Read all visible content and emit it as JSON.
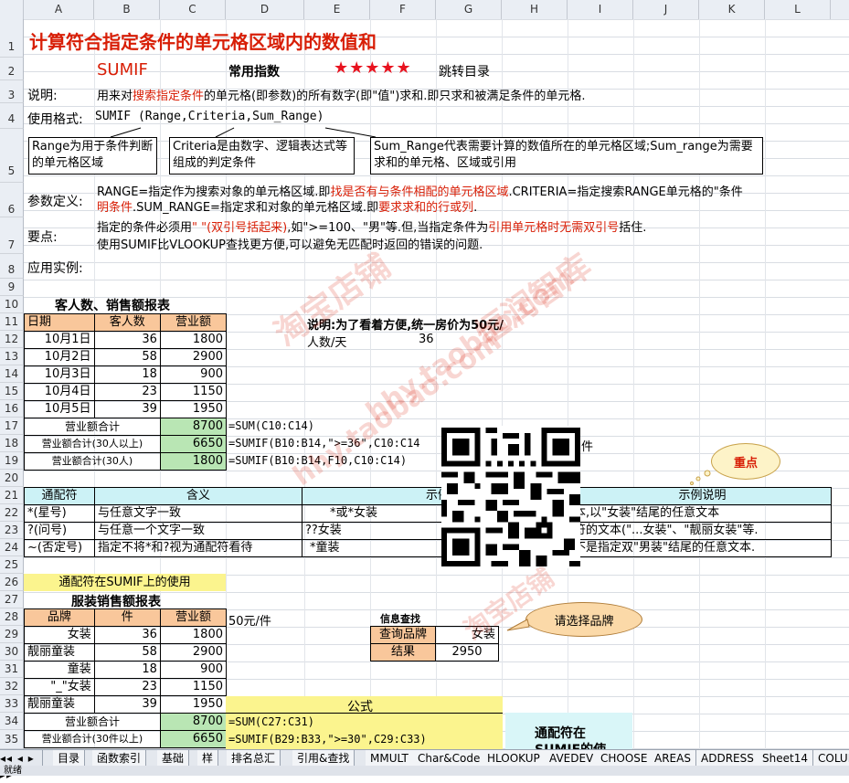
{
  "columns": [
    "A",
    "B",
    "C",
    "D",
    "E",
    "F",
    "G",
    "H",
    "I",
    "J",
    "K",
    "L"
  ],
  "rows": [
    "1",
    "2",
    "3",
    "4",
    "5",
    "6",
    "7",
    "8",
    "9",
    "10",
    "11",
    "12",
    "13",
    "14",
    "15",
    "16",
    "17",
    "18",
    "19",
    "20",
    "21",
    "22",
    "23",
    "24",
    "25",
    "26",
    "27",
    "28",
    "29",
    "30",
    "31",
    "32",
    "33",
    "34",
    "35"
  ],
  "title": "计算符合指定条件的单元格区域内的数值和",
  "func_name": "SUMIF",
  "common_label": "常用指数",
  "stars": "★★★★★",
  "jump_link": "跳转目录",
  "desc_label": "说明:",
  "desc_a": "用来对",
  "desc_b": "搜索指定条件",
  "desc_c": "的单元格(即参数)的所有数字(即\"值\")求和.即只求和被满足条件的单元格.",
  "format_label": "使用格式:",
  "format_text": "SUMIF (Range,Criteria,Sum_Range)",
  "box_range": "Range为用于条件判断的单元格区域",
  "box_criteria": "Criteria是由数字、逻辑表达式等组成的判定条件",
  "box_sumrange": "Sum_Range代表需要计算的数值所在的单元格区域;Sum_range为需要求和的单元格、区域或引用",
  "param_label": "参数定义:",
  "param_a": "RANGE=指定作为搜索对象的单元格区域.即",
  "param_b": "找是否有与条件相配的单元格区域",
  "param_c": ".CRITERIA=指定搜索RANGE单元格的\"条件",
  "param_d": "明条件",
  "param_e": ".SUM_RANGE=指定求和对象的单元格区域.即",
  "param_f": "要求求和的行或列",
  "param_g": ".",
  "key_label": "要点:",
  "key_a": "指定的条件必须用",
  "key_b": "\" \"(双引号括起来)",
  "key_c": ",如\">=100、\"男\"等.但,当指定条件为",
  "key_d": "引用单元格时无需双引号",
  "key_e": "括住.",
  "key_line2": "使用SUMIF比VLOOKUP查找更方便,可以避免无匹配时返回的错误的问题.",
  "example_label": "应用实例:",
  "table1": {
    "title": "客人数、销售额报表",
    "headers": [
      "日期",
      "客人数",
      "营业额"
    ],
    "rows": [
      [
        "10月1日",
        "36",
        "1800"
      ],
      [
        "10月2日",
        "58",
        "2900"
      ],
      [
        "10月3日",
        "18",
        "900"
      ],
      [
        "10月4日",
        "23",
        "1150"
      ],
      [
        "10月5日",
        "39",
        "1950"
      ]
    ],
    "sum_rows": [
      {
        "label": "营业额合计",
        "value": "8700",
        "formula": "=SUM(C10:C14)"
      },
      {
        "label": "营业额合计(30人以上)",
        "value": "6650",
        "formula": "=SUMIF(B10:B14,\">=36\",C10:C14"
      },
      {
        "label": "营业额合计(30人)",
        "value": "1800",
        "formula": "=SUMIF(B10:B14,F10,C10:C14)"
      }
    ]
  },
  "note_bold": "说明:为了看着方便,统一房价为50元/",
  "note_people_label": "人数/天",
  "note_people_value": "36",
  "g18_tail": "件",
  "highlight_bubble": "重点",
  "wildcard": {
    "headers": [
      "通配符",
      "含义",
      "示例",
      "示例说明"
    ],
    "rows": [
      [
        "*(星号)",
        "与任意文字一致",
        "*或*女装",
        "本,以\"女装\"结尾的任意文本"
      ],
      [
        "?(问号)",
        "与任意一个文字一致",
        "??女装",
        "符的文本(\"...女装\"、\"靓丽女装\"等."
      ],
      [
        "~(否定号)",
        "指定不将*和?视为通配符看待",
        "*童装",
        "不是指定双\"男装\"结尾的任意文本."
      ]
    ]
  },
  "wildcard_use": "通配符在SUMIF上的使用",
  "table2": {
    "title": "服装销售额报表",
    "headers": [
      "品牌",
      "件",
      "营业额"
    ],
    "rows": [
      [
        "女装",
        "36",
        "1800"
      ],
      [
        "靓丽童装",
        "58",
        "2900"
      ],
      [
        "童装",
        "18",
        "900"
      ],
      [
        "\"_\"女装",
        "23",
        "1150"
      ],
      [
        "靓丽童装",
        "39",
        "1950"
      ]
    ],
    "sum_rows": [
      {
        "label": "营业额合计",
        "value": "8700",
        "formula": "=SUM(C27:C31)"
      },
      {
        "label": "营业额合计(30件以上)",
        "value": "6650",
        "formula": "=SUMIF(B29:B33,\">=30\",C29:C33)"
      }
    ],
    "price_note": "50元/件",
    "formula_header": "公式"
  },
  "lookup": {
    "title": "信息查找",
    "query_label": "查询品牌",
    "query_value": "女装",
    "result_label": "结果",
    "result_value": "2950",
    "bubble": "请选择品牌"
  },
  "wildcard_box": "通配符在 SUMIF的使",
  "sheet_tabs": [
    "目录",
    "函数索引",
    "基础",
    "样",
    "排名总汇",
    "引用&查找",
    "MMULT",
    "Char&Code",
    "HLOOKUP",
    "AVEDEV",
    "CHOOSE",
    "AREAS",
    "ADDRESS",
    "Sheet14",
    "COLUM"
  ],
  "status_text": "就绪",
  "watermark": [
    "淘宝店铺",
    "hhy.taobao.com",
    "恒润智库"
  ]
}
